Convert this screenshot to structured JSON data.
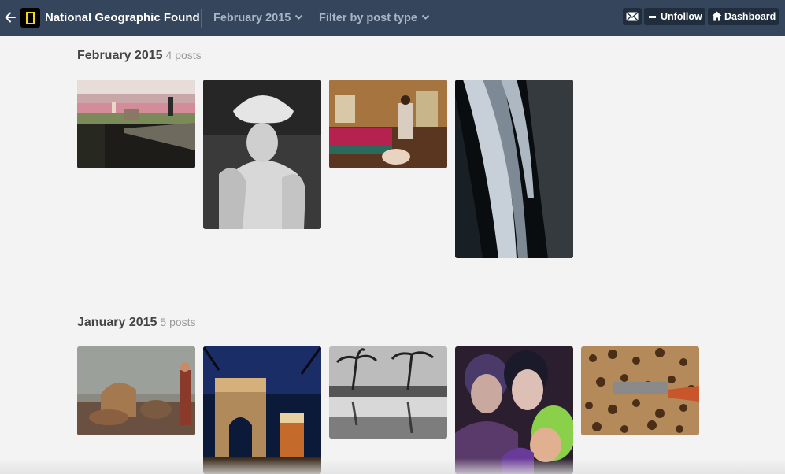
{
  "header": {
    "blog_title": "National Geographic Found",
    "month_dropdown": "February 2015",
    "filter_dropdown": "Filter by post type",
    "unfollow_label": "Unfollow",
    "dashboard_label": "Dashboard",
    "colors": {
      "bar": "#35465c",
      "button": "#1f2d3d",
      "dropdown_text": "#a9b5c5",
      "logo_yellow": "#f7d61b"
    }
  },
  "sections": [
    {
      "title": "February 2015",
      "count": "4 posts",
      "posts": [
        "Tulip field reflected in canal with footbridge",
        "Woman in large feathered hat, black and white",
        "Woman in room with pink sofa",
        "Waterfall plunging into dark gorge"
      ]
    },
    {
      "title": "January 2015",
      "count": "5 posts",
      "posts": [
        "Lion diorama with figure",
        "Arc de Triomphe at night",
        "Palm trees reflected in water, black and white",
        "Women with dramatic makeup",
        "Leopard fur close-up"
      ]
    }
  ]
}
